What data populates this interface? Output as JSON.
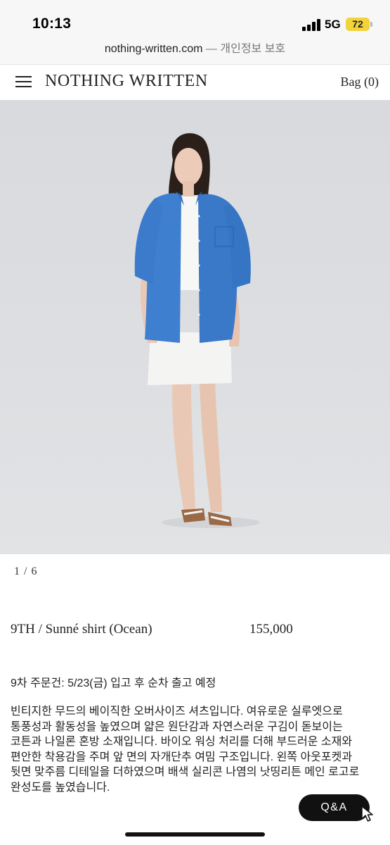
{
  "status_bar": {
    "time": "10:13",
    "network": "5G",
    "battery": "72"
  },
  "url_bar": {
    "domain": "nothing-written.com",
    "separator": "—",
    "privacy": "개인정보 보호"
  },
  "header": {
    "brand": "NOTHING WRITTEN",
    "bag": "Bag (0)",
    "menu_icon": "hamburger-menu-icon"
  },
  "gallery": {
    "counter": "1 / 6"
  },
  "product": {
    "name": "9TH / Sunné shirt (Ocean)",
    "price": "155,000",
    "order_notice": "9차 주문건: 5/23(금) 입고 후 순차 출고 예정",
    "description_lines": [
      "빈티지한 무드의 베이직한 오버사이즈 셔츠입니다. 여유로운 실루엣으로",
      "통풍성과 활동성을 높였으며 얇은 원단감과 자연스러운 구김이 돋보이는",
      "코튼과 나일론 혼방 소재입니다. 바이오 워싱 처리를 더해 부드러운 소재와",
      "편안한 착용감을 주며 앞 면의 자개단추 여밈 구조입니다. 왼쪽 아웃포켓과",
      "뒷면 맞주름 디테일을 더하였으며 배색 실리콘 나염의 낫띵리튼 메인 로고로",
      "완성도를 높였습니다."
    ]
  },
  "qa_button": {
    "label": "Q&A"
  },
  "colors": {
    "shirt": "#3f7fd0",
    "background": "#dcdee1",
    "button": "#111111",
    "battery": "#f2d33a"
  }
}
